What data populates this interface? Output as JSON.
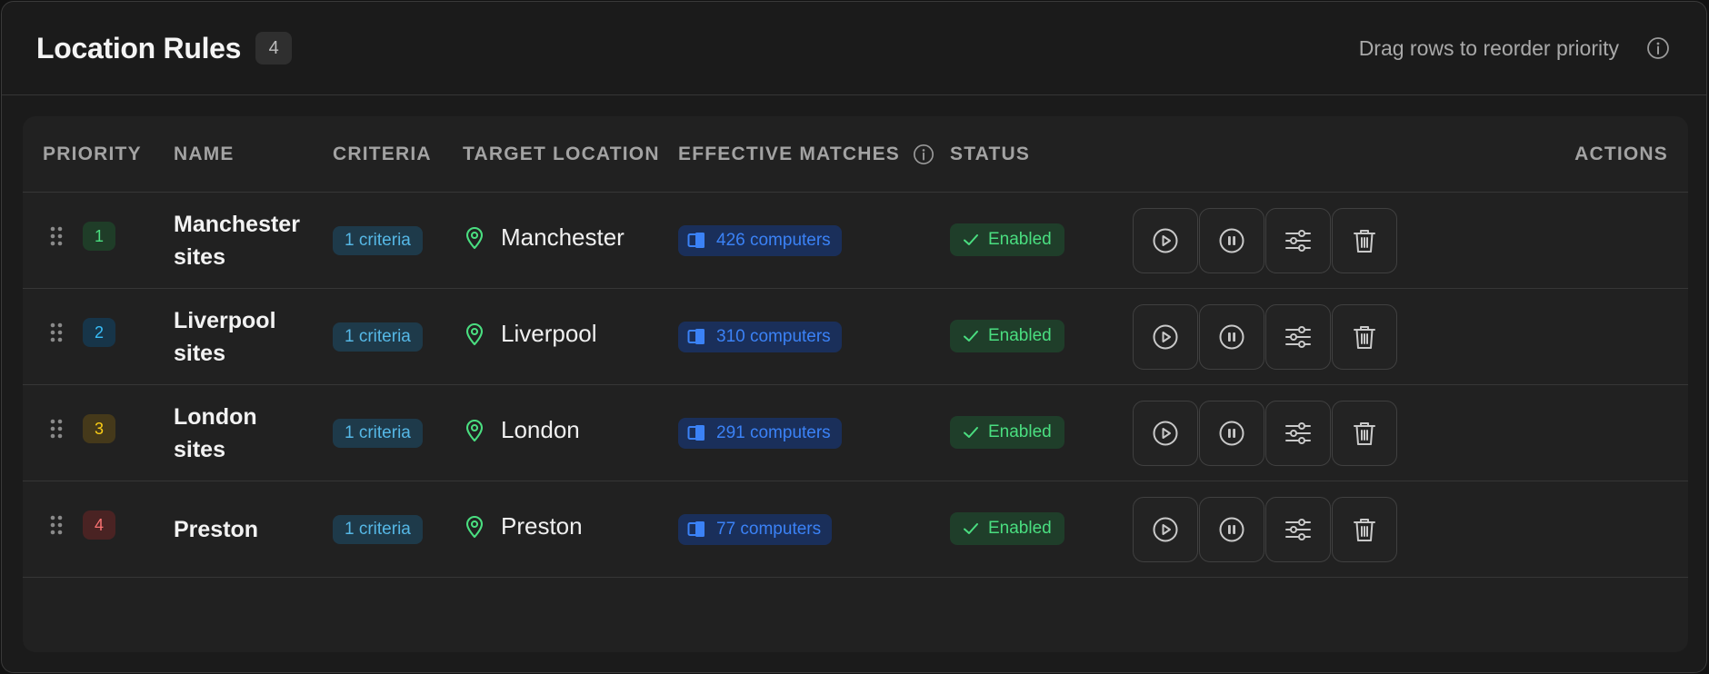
{
  "header": {
    "title": "Location Rules",
    "count": "4",
    "hint": "Drag rows to reorder priority"
  },
  "columns": {
    "priority": "PRIORITY",
    "name": "NAME",
    "criteria": "CRITERIA",
    "target_location": "TARGET LOCATION",
    "effective_matches": "EFFECTIVE MATCHES",
    "status": "STATUS",
    "actions": "ACTIONS"
  },
  "rows": [
    {
      "priority": "1",
      "priority_color": "#4ade80",
      "priority_bg": "#1f3d28",
      "name_line1": "Manchester",
      "name_line2": "sites",
      "criteria": "1 criteria",
      "location": "Manchester",
      "matches": "426 computers",
      "status": "Enabled"
    },
    {
      "priority": "2",
      "priority_color": "#38bdf8",
      "priority_bg": "#173549",
      "name_line1": "Liverpool",
      "name_line2": "sites",
      "criteria": "1 criteria",
      "location": "Liverpool",
      "matches": "310 computers",
      "status": "Enabled"
    },
    {
      "priority": "3",
      "priority_color": "#facc15",
      "priority_bg": "#45391a",
      "name_line1": "London",
      "name_line2": "sites",
      "criteria": "1 criteria",
      "location": "London",
      "matches": "291 computers",
      "status": "Enabled"
    },
    {
      "priority": "4",
      "priority_color": "#f87171",
      "priority_bg": "#4a2323",
      "name_line1": "Preston",
      "name_line2": "",
      "criteria": "1 criteria",
      "location": "Preston",
      "matches": "77 computers",
      "status": "Enabled"
    }
  ],
  "icons": {
    "header_info": "info-icon",
    "matches_info": "info-icon",
    "drag": "grip-vertical-icon",
    "location": "map-pin-icon",
    "matches": "devices-icon",
    "status": "check-icon",
    "actions": [
      "play-icon",
      "pause-icon",
      "sliders-icon",
      "trash-icon"
    ]
  },
  "colors": {
    "criteria_text": "#56b8e6",
    "matches_text": "#3b82f6",
    "status_text": "#4ade80"
  }
}
